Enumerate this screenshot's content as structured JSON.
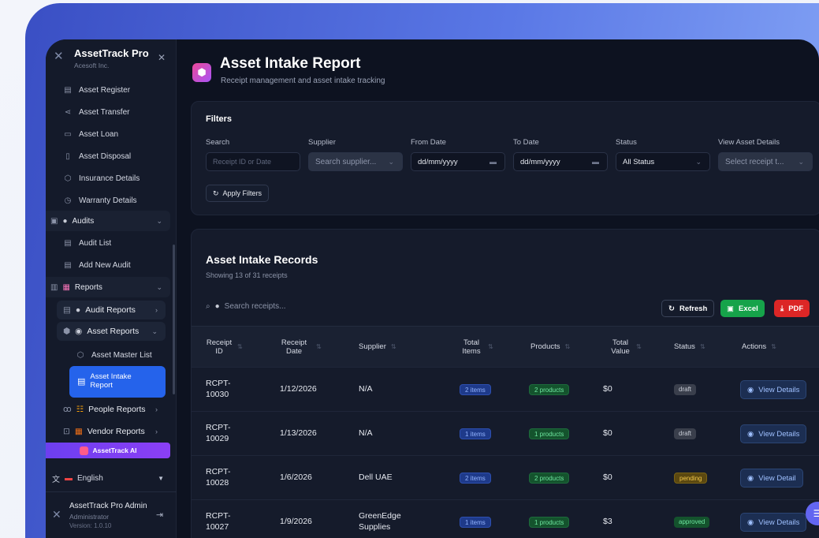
{
  "brand": {
    "name": "AssetTrack Pro",
    "org": "Acesoft Inc."
  },
  "sidebar": {
    "items": [
      {
        "label": "Asset Register",
        "icon": "document-icon"
      },
      {
        "label": "Asset Transfer",
        "icon": "share-icon"
      },
      {
        "label": "Asset Loan",
        "icon": "card-icon"
      },
      {
        "label": "Asset Disposal",
        "icon": "trash-icon"
      },
      {
        "label": "Insurance Details",
        "icon": "shield-icon"
      },
      {
        "label": "Warranty Details",
        "icon": "clock-icon"
      }
    ],
    "audits": {
      "label": "Audits",
      "items": [
        "Audit List",
        "Add New Audit"
      ]
    },
    "reports": {
      "label": "Reports",
      "audit_reports": "Audit Reports",
      "asset_reports": "Asset Reports",
      "asset_master_list": "Asset Master List",
      "asset_intake_report": "Asset Intake Report",
      "people_reports": "People Reports",
      "vendor_reports": "Vendor Reports"
    },
    "ai_button": "AssetTrack AI",
    "language": "English",
    "user": {
      "name": "AssetTrack Pro Admin",
      "role": "Administrator",
      "version": "Version: 1.0.10"
    }
  },
  "header": {
    "title": "Asset Intake Report",
    "subtitle": "Receipt management and asset intake tracking"
  },
  "filters": {
    "title": "Filters",
    "search": {
      "label": "Search",
      "placeholder": "Receipt ID or Date"
    },
    "supplier": {
      "label": "Supplier",
      "value": "Search supplier..."
    },
    "from_date": {
      "label": "From Date",
      "value": "dd/mm/yyyy"
    },
    "to_date": {
      "label": "To Date",
      "value": "dd/mm/yyyy"
    },
    "status": {
      "label": "Status",
      "value": "All Status"
    },
    "view_details": {
      "label": "View Asset Details",
      "value": "Select receipt t..."
    },
    "apply_label": "Apply Filters"
  },
  "records": {
    "title": "Asset Intake Records",
    "subtitle": "Showing 13 of 31 receipts",
    "search_placeholder": "Search receipts...",
    "refresh_label": "Refresh",
    "excel_label": "Excel",
    "pdf_label": "PDF",
    "columns": [
      "Receipt ID",
      "Receipt Date",
      "Supplier",
      "Total Items",
      "Products",
      "Total Value",
      "Status",
      "Actions"
    ],
    "rows": [
      {
        "id": "RCPT-10030",
        "date": "1/12/2026",
        "supplier": "N/A",
        "items": "2 items",
        "products": "2 products",
        "value": "$0",
        "status": "draft",
        "action": "View Details"
      },
      {
        "id": "RCPT-10029",
        "date": "1/13/2026",
        "supplier": "N/A",
        "items": "1 items",
        "products": "1 products",
        "value": "$0",
        "status": "draft",
        "action": "View Details"
      },
      {
        "id": "RCPT-10028",
        "date": "1/6/2026",
        "supplier": "Dell UAE",
        "items": "2 items",
        "products": "2 products",
        "value": "$0",
        "status": "pending",
        "action": "View Detail"
      },
      {
        "id": "RCPT-10027",
        "date": "1/9/2026",
        "supplier": "GreenEdge Supplies",
        "items": "1 items",
        "products": "1 products",
        "value": "$3",
        "status": "approved",
        "action": "View Details"
      }
    ]
  }
}
